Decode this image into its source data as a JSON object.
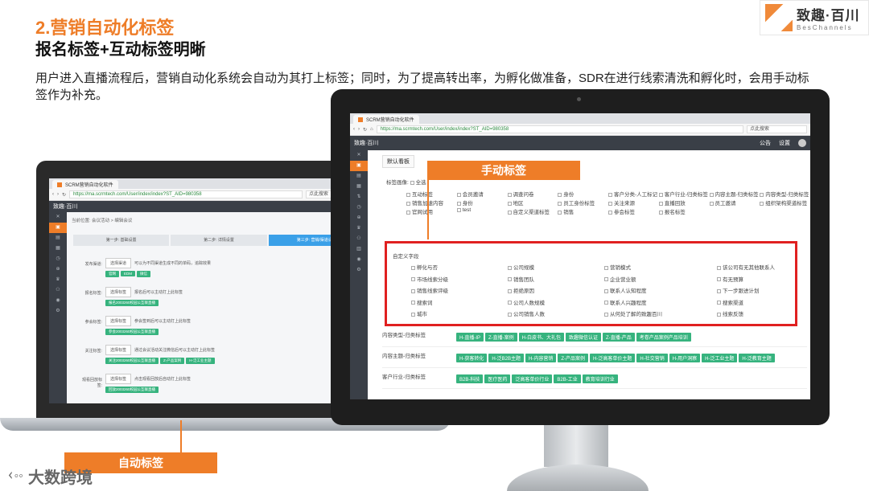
{
  "slide": {
    "title": "2.营销自动化标签",
    "subtitle": "报名标签+互动标签明晰",
    "intro": "用户进入直播流程后，营销自动化系统会自动为其打上标签；同时，为了提高转出率，为孵化做准备，SDR在进行线索清洗和孵化时，会用手动标签作为补充。",
    "logo_cn": "致趣·百川",
    "logo_en": "BesChannels",
    "manual_label": "手动标签",
    "auto_label": "自动标签",
    "footer_logo": "大数跨境",
    "accent": "#ee7d28"
  },
  "monitor": {
    "tab_title": "SCRM营销自动化软件",
    "url": "https://ma.scrmtech.com/User/index/index?ST_AID=980358",
    "search_placeholder": "点此搜索",
    "app_brand": "致趣·百川",
    "notice": "公告",
    "settings": "设置",
    "view_tab": "默认看板",
    "portrait_label": "标签画像:",
    "select_all": "全选",
    "tag_grid": [
      "互动标签",
      "会员邀请",
      "调查问卷",
      "身份",
      "客户分类-人工标记",
      "客户行业-归类标签",
      "内容主题-归类标签",
      "内容类型-归类标签",
      "销售加速内容",
      "身份",
      "地区",
      "员工身份标签",
      "关注来源",
      "直播回放",
      "员工邀请",
      "组织架构渠道标签",
      "官网试用",
      "test",
      "自定义渠道标签",
      "销售",
      "参会标签",
      "报名标签"
    ],
    "custom_field_label": "自定义字段",
    "custom_fields": [
      [
        "孵化与否",
        "公司规模",
        "营销模式",
        "该公司有无其他联系人"
      ],
      [
        "市场线索分级",
        "销售团队",
        "企业营业额",
        "有无预算"
      ],
      [
        "销售线索评级",
        "拒绝原因",
        "联系人认知程度",
        "下一步跟进计划"
      ],
      [
        "搜索词",
        "公司人数规模",
        "联系人兴趣程度",
        "搜索渠道"
      ],
      [
        "城市",
        "公司销售人数",
        "从何处了解的致趣百川",
        "线索反馈"
      ]
    ],
    "sections": [
      {
        "label": "内容类型-归类标签",
        "tags": [
          "H-直播-IP",
          "Z-直播-案例",
          "H-白皮书、大礼包",
          "致趣微信认证",
          "Z-直播-产品",
          "考卷产品案例产品培训"
        ]
      },
      {
        "label": "内容主题-归类标签",
        "tags": [
          "H-获客转化",
          "H-泛B2B主题",
          "H-内容营销",
          "Z-产品案例",
          "H-泛高客单价主题",
          "H-社交营销",
          "H-用户洞察",
          "H-泛工业主题",
          "H-泛教育主题"
        ]
      },
      {
        "label": "客户行业-归类标签",
        "tags": [
          "B2B-科技",
          "医疗医药",
          "泛高客单价行业",
          "B2B-工业",
          "教育培训行业"
        ]
      }
    ]
  },
  "laptop": {
    "tab_title": "SCRM营销自动化软件",
    "url": "https://ma.scrmtech.com/User/index/index?ST_AID=980358",
    "search_placeholder": "点此搜索",
    "breadcrumb": "当前位置: 会议活动 > 编辑会议",
    "steps": [
      "第一步: 基础设置",
      "第二步: 详情设置",
      "第三步: 营销/渠道设置"
    ],
    "rows": [
      {
        "label": "发布渠道:",
        "btn": "选择渠道",
        "hint": "可以为不同渠道生成不同的单码，追踪效果",
        "tags": [
          "官网",
          "EDM",
          "微信"
        ]
      },
      {
        "label": "报名标签:",
        "btn": "选择标签",
        "hint": "报名后可以主动打上此标签",
        "tags": [
          "报名2003260校园公互联直播"
        ]
      },
      {
        "label": "参会标签:",
        "btn": "选择标签",
        "hint": "参会签到后可以主动打上此标签",
        "tags": [
          "参会2003260校园公互联直播"
        ]
      },
      {
        "label": "关注标签:",
        "btn": "选择标签",
        "hint": "通过会议活动关注微信后可以主动打上此标签",
        "tags": [
          "关注2003260校园公互联直播",
          "Z-产品案例",
          "H-泛工业主题"
        ]
      },
      {
        "label": "观看回放标签:",
        "btn": "选择标签",
        "hint": "点击观看回放后自动打上此标签",
        "tags": [
          "回放2003260校园公互联直播"
        ]
      }
    ]
  }
}
